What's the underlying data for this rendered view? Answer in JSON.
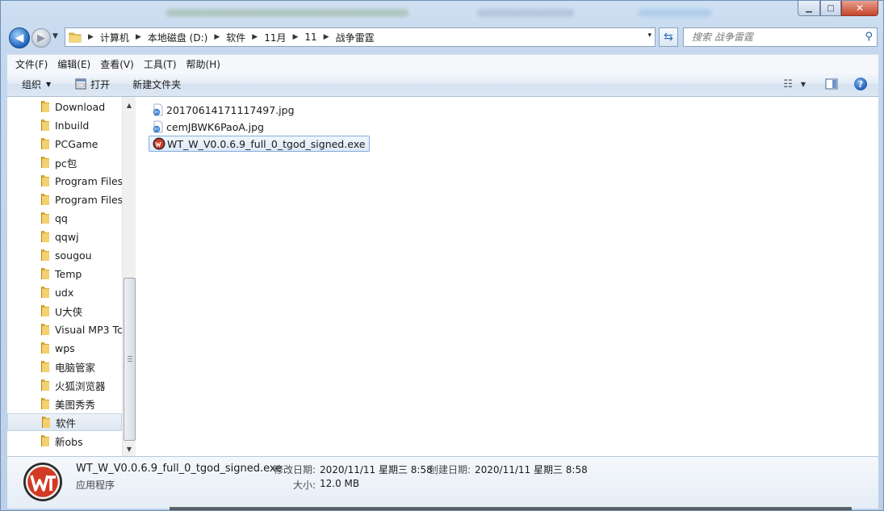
{
  "window": {
    "caption": {
      "minimize": "▁",
      "maximize": "□",
      "close": "✕"
    }
  },
  "address": {
    "crumbs": [
      "计算机",
      "本地磁盘 (D:)",
      "软件",
      "11月",
      "11",
      "战争雷霆"
    ],
    "dropdown_glyph": "▾"
  },
  "search": {
    "placeholder": "搜索 战争雷霆",
    "icon": "search-icon"
  },
  "menu": [
    "文件(F)",
    "编辑(E)",
    "查看(V)",
    "工具(T)",
    "帮助(H)"
  ],
  "toolbar": {
    "organize": "组织",
    "open": "打开",
    "new_folder": "新建文件夹",
    "view_glyph": "☷",
    "help": "?"
  },
  "nav": {
    "items": [
      "Download",
      "Inbuild",
      "PCGame",
      "pc包",
      "Program Files",
      "Program Files",
      "qq",
      "qqwj",
      "sougou",
      "Temp",
      "udx",
      "U大侠",
      "Visual MP3 Tc",
      "wps",
      "电脑管家",
      "火狐浏览器",
      "美图秀秀",
      "软件",
      "新obs"
    ],
    "selected_index": 17
  },
  "files": [
    {
      "name": "20170614171117497.jpg",
      "icon": "jpeg-file-icon"
    },
    {
      "name": "cemJBWK6PaoA.jpg",
      "icon": "jpeg-file-icon"
    },
    {
      "name": "WT_W_V0.0.6.9_full_0_tgod_signed.exe",
      "icon": "warthunder-exe-icon"
    }
  ],
  "selected_file_index": 2,
  "details": {
    "name": "WT_W_V0.0.6.9_full_0_tgod_signed.exe",
    "type": "应用程序",
    "modified_label": "修改日期:",
    "modified_value": "2020/11/11 星期三 8:58",
    "created_label": "创建日期:",
    "created_value": "2020/11/11 星期三 8:58",
    "size_label": "大小:",
    "size_value": "12.0 MB"
  },
  "colors": {
    "accent": "#3c7fb1",
    "selection": "#dce9f8",
    "folder": "#e8c050"
  }
}
